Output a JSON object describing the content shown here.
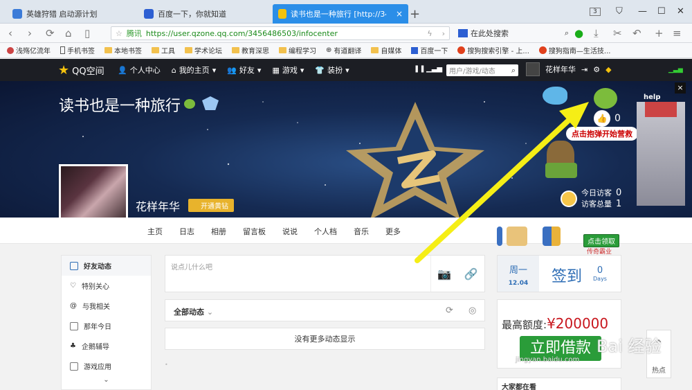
{
  "browser": {
    "tabs": [
      {
        "label": "英雄狩猎 启动源计划",
        "active": false
      },
      {
        "label": "百度一下，你就知道",
        "active": false
      },
      {
        "label": "读书也是一种旅行 [http://34564865",
        "active": true
      }
    ],
    "tab_count": "3",
    "url_site": "腾讯",
    "url": "https://user.qzone.qq.com/3456486503/infocenter",
    "search_placeholder": "在此处搜索",
    "bookmarks": [
      "浅殇亿流年",
      "手机书签",
      "本地书签",
      "工具",
      "学术论坛",
      "教育深思",
      "编程学习",
      "有道翻译",
      "自媒体",
      "百度一下",
      "搜狗搜索引擎 - 上...",
      "搜狗指南—生活技..."
    ]
  },
  "qq_nav": {
    "logo": "QQ空间",
    "menu": [
      "个人中心",
      "我的主页",
      "好友",
      "游戏",
      "装扮"
    ],
    "search_placeholder": "用户/游戏/动态",
    "username": "花样年华"
  },
  "banner": {
    "title": "读书也是一种旅行",
    "like_count": "0",
    "game_label": "点击抱弹开始营救",
    "help": "help",
    "visitors_today_label": "今日访客",
    "visitors_today": "0",
    "visitors_total_label": "访客总量",
    "visitors_total": "1",
    "close": "×"
  },
  "profile": {
    "nickname": "花样年华",
    "vip_label": "开通黄钻"
  },
  "profile_tabs": [
    "主页",
    "日志",
    "相册",
    "留言板",
    "说说",
    "个人档",
    "音乐",
    "更多"
  ],
  "left_menu": [
    "好友动态",
    "特别关心",
    "与我相关",
    "那年今日",
    "企鹅辅导",
    "游戏应用"
  ],
  "post": {
    "placeholder": "说点儿什么吧"
  },
  "feed": {
    "filter": "全部动态",
    "empty": "没有更多动态显示"
  },
  "right": {
    "prize_button": "点击领取",
    "prize_sub": "传奇霸业",
    "weekday": "周一",
    "date": "12.04",
    "signin": "签到",
    "signin_days": "0",
    "signin_unit": "Days",
    "ad_limit_label": "最高额度:",
    "ad_amount": "¥200000",
    "ad_cta": "立即借款",
    "watermark": "Bai 经验",
    "watermark_url": "jingyan.baidu.com",
    "totop_label": "热点",
    "hot_title": "大家都在看"
  },
  "colors": {
    "accent": "#2b8ee8",
    "qq_nav_bg": "#1c1e24",
    "arrow": "#f5ee16",
    "brand_green": "#2a9c39"
  }
}
